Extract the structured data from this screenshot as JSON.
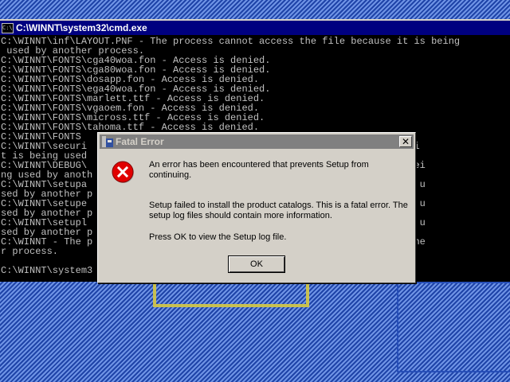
{
  "console": {
    "title": "C:\\WINNT\\system32\\cmd.exe",
    "lines": [
      "C:\\WINNT\\inf\\LAYOUT.PNF - The process cannot access the file because it is being",
      " used by another process.",
      "C:\\WINNT\\FONTS\\cga40woa.fon - Access is denied.",
      "C:\\WINNT\\FONTS\\cga80woa.fon - Access is denied.",
      "C:\\WINNT\\FONTS\\dosapp.fon - Access is denied.",
      "C:\\WINNT\\FONTS\\ega40woa.fon - Access is denied.",
      "C:\\WINNT\\FONTS\\marlett.ttf - Access is denied.",
      "C:\\WINNT\\FONTS\\vgaoem.fon - Access is denied.",
      "C:\\WINNT\\FONTS\\micross.ttf - Access is denied.",
      "C:\\WINNT\\FONTS\\tahoma.ttf - Access is denied.",
      "C:\\WINNT\\FONTS",
      "C:\\WINNT\\securi                                            file because i",
      "t is being used",
      "C:\\WINNT\\DEBUG\\                                            cause it is bei",
      "ng used by anoth",
      "C:\\WINNT\\setupa                                            e it is being u",
      "sed by another p",
      "C:\\WINNT\\setupe                                            e it is being u",
      "sed by another p",
      "C:\\WINNT\\setupl                                            e it is being u",
      "sed by another p",
      "C:\\WINNT - The p                                            used by anothe",
      "r process.",
      "",
      "C:\\WINNT\\system3"
    ]
  },
  "dialog": {
    "title": "Fatal Error",
    "close_glyph": "✕",
    "message_1": "An error has been encountered that prevents Setup from continuing.",
    "message_2": "Setup failed to install the product catalogs. This is a fatal error. The setup log files should contain more information.",
    "message_3": "Press OK to view the Setup log file.",
    "ok_label": "OK",
    "icon": "error-icon",
    "accent_color": "#cc0000"
  }
}
